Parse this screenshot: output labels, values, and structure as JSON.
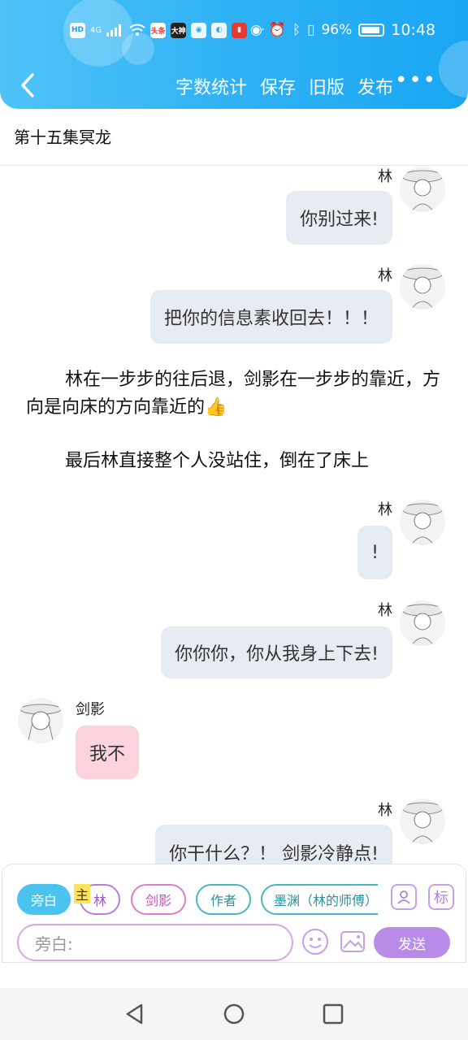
{
  "status_bar": {
    "left_icons": [
      "HD",
      "4G",
      "头条",
      "大神"
    ],
    "battery": "96%",
    "time": "10:48"
  },
  "toolbar": {
    "back_icon": "chevron-left-icon",
    "actions": [
      "字数统计",
      "保存",
      "旧版",
      "发布"
    ],
    "more_label": "•••"
  },
  "chapter_title": "第十五集冥龙",
  "messages": [
    {
      "side": "right",
      "name": "林",
      "text": "你别过来!"
    },
    {
      "side": "right",
      "name": "林",
      "text": "把你的信息素收回去！！！"
    },
    {
      "side": "narration",
      "text": "林在一步步的往后退，剑影在一步步的靠近，方向是向床的方向靠近的👍"
    },
    {
      "side": "narration",
      "text": "最后林直接整个人没站住，倒在了床上"
    },
    {
      "side": "right",
      "name": "林",
      "text": "!"
    },
    {
      "side": "right",
      "name": "林",
      "text": "你你你，你从我身上下去!"
    },
    {
      "side": "left",
      "name": "剑影",
      "text": "我不"
    },
    {
      "side": "right",
      "name": "林",
      "text": "你干什么？！ 剑影冷静点!"
    }
  ],
  "roles": {
    "narrator": "旁白",
    "main_tag": "主",
    "lin": "林",
    "jianying": "剑影",
    "author": "作者",
    "mentor": "墨渊（林的师傅）",
    "tag_label": "标"
  },
  "composer": {
    "placeholder": "旁白:",
    "send_label": "发送"
  },
  "colors": {
    "header": "#2fb2f5",
    "bubble_right": "#e7ebf2",
    "bubble_left": "#fbd3dd",
    "send": "#b98be9"
  }
}
